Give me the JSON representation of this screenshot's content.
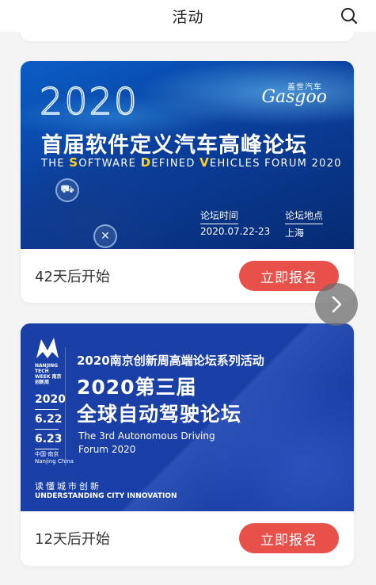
{
  "header": {
    "title": "活动",
    "search_icon": "search-icon"
  },
  "events": [
    {
      "banner": {
        "year": "2020",
        "logo_cn": "盖世汽车",
        "logo_en": "Gasgoo",
        "title_cn": "首届软件定义汽车高峰论坛",
        "title_en_parts": [
          "THE ",
          "S",
          "OFTWARE ",
          "D",
          "EFINED ",
          "V",
          "EHICLES FORUM 2020"
        ],
        "time_label": "论坛时间",
        "time_value": "2020.07.22-23",
        "place_label": "论坛地点",
        "place_value": "上海"
      },
      "countdown": "42天后开始",
      "register_label": "立即报名"
    },
    {
      "banner": {
        "week_tag": "NANJING TECH WEEK 南京创新周",
        "year": "2020",
        "date1": "6.22",
        "date2": "6.23",
        "location": "中国·南京",
        "location_en": "Nanjing China",
        "series": "2020南京创新周高端论坛系列活动",
        "headline_1": "2020第三届",
        "headline_2": "全球自动驾驶论坛",
        "en_line_1": "The 3rd Autonomous Driving",
        "en_line_2": "Forum 2020",
        "slogan_cn": "读懂城市创新",
        "slogan_en": "UNDERSTANDING CITY INNOVATION"
      },
      "countdown": "12天后开始",
      "register_label": "立即报名"
    }
  ],
  "colors": {
    "accent": "#e8504a",
    "banner1": "#0b3f9c",
    "banner2": "#1a3fa6"
  }
}
